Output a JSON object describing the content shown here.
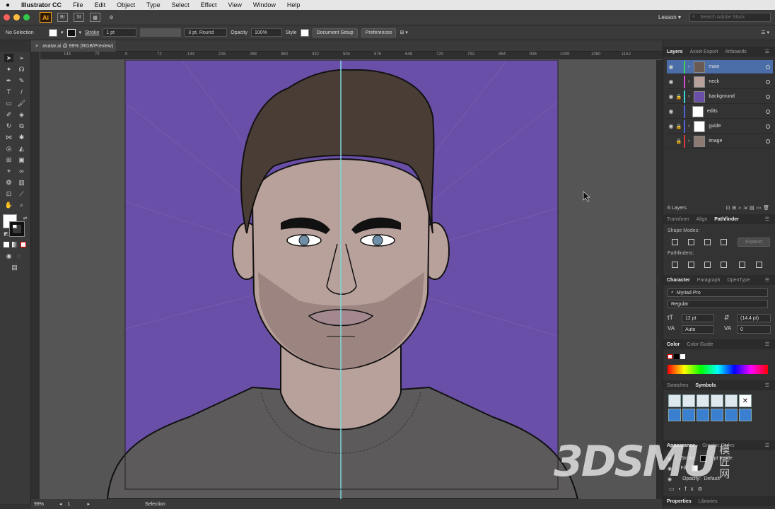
{
  "menubar": {
    "apple": "",
    "app_name": "Illustrator CC",
    "items": [
      "File",
      "Edit",
      "Object",
      "Type",
      "Select",
      "Effect",
      "View",
      "Window",
      "Help"
    ]
  },
  "appbar": {
    "logo": "Ai",
    "bridge": "Br",
    "stock_icon": "St",
    "workspace": "Lesson",
    "search_placeholder": "Search Adobe Stock"
  },
  "controlbar": {
    "selection": "No Selection",
    "stroke_label": "Stroke",
    "stroke_weight": "1 pt",
    "brush": "3 pt. Round",
    "opacity_label": "Opacity",
    "opacity_value": "100%",
    "style_label": "Style",
    "doc_setup": "Document Setup",
    "preferences": "Preferences"
  },
  "document": {
    "tab_title": "avatar.ai @ 99% (RGB/Preview)",
    "close": "×"
  },
  "ruler": {
    "marks": [
      "144",
      "72",
      "0",
      "72",
      "144",
      "216",
      "288",
      "360",
      "432",
      "504",
      "576",
      "648",
      "720",
      "792",
      "864",
      "936",
      "1008",
      "1080",
      "1152"
    ]
  },
  "statusbar": {
    "zoom": "99%",
    "artboard": "1",
    "tool": "Selection"
  },
  "layers_panel": {
    "tabs": [
      "Layers",
      "Asset Export",
      "Artboards"
    ],
    "layers": [
      {
        "name": "main",
        "color": "#3fd15a"
      },
      {
        "name": "neck",
        "color": "#d24bd6"
      },
      {
        "name": "background",
        "color": "#3ad6d6"
      },
      {
        "name": "edits",
        "color": "#4c62d8"
      },
      {
        "name": "guide",
        "color": "#4c62d8"
      },
      {
        "name": "image",
        "color": "#d83a3a"
      }
    ],
    "count": "6 Layers"
  },
  "pathfinder_panel": {
    "tabs": [
      "Transform",
      "Align",
      "Pathfinder"
    ],
    "shape_modes": "Shape Modes:",
    "expand": "Expand",
    "pathfinders": "Pathfinders:"
  },
  "character_panel": {
    "tabs": [
      "Character",
      "Paragraph",
      "OpenType"
    ],
    "font": "Myriad Pro",
    "style": "Regular",
    "size": "12 pt",
    "leading": "(14.4 pt)",
    "kerning": "Auto",
    "tracking": "0"
  },
  "color_panel": {
    "tabs": [
      "Color",
      "Color Guide"
    ]
  },
  "symbols_panel": {
    "tabs": [
      "Swatches",
      "Symbols"
    ]
  },
  "appearance_panel": {
    "tabs": [
      "Appearance",
      "Graphic Styles"
    ],
    "stroke_label": "Stroke:",
    "stroke_value": "1 pt Inside",
    "fill_label": "Fill:",
    "opacity_label": "Opacity:",
    "opacity_value": "Default"
  },
  "bottom_tabs": [
    "Properties",
    "Libraries"
  ],
  "watermark": {
    "text": "3DSMU",
    "cjk": "模匠网"
  },
  "colors": {
    "purple": "#6a4fa8",
    "hair": "#4a3d36",
    "skin": "#b9a19b",
    "beard": "#9c8580",
    "shirt": "#5c5a5b",
    "accent": "#4b6ea8"
  }
}
